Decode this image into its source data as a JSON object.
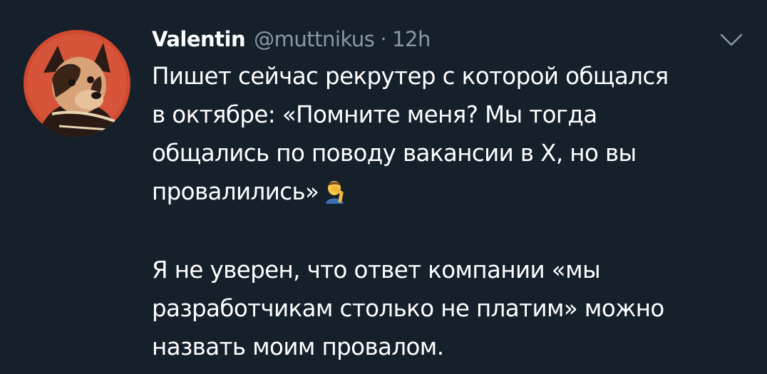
{
  "tweet": {
    "author": {
      "display_name": "Valentin",
      "handle": "@muttnikus",
      "separator": "·",
      "time": "12h",
      "avatar_icon": "dog-portrait-avatar"
    },
    "menu_icon": "chevron-down-icon",
    "paragraph1": {
      "lines": [
        "Пишет сейчас рекрутер с которой общался",
        "в октябре: «Помните меня? Мы тогда",
        "общались по поводу вакансии в Х, но вы",
        "провалились»"
      ],
      "emoji": "facepalm-emoji"
    },
    "paragraph2": {
      "lines": [
        "Я не уверен, что ответ компании «мы",
        "разработчикам столько не платим» можно",
        "назвать моим провалом."
      ]
    }
  },
  "colors": {
    "background": "#15202b",
    "text": "#ffffff",
    "secondary_text": "#8899a6"
  }
}
